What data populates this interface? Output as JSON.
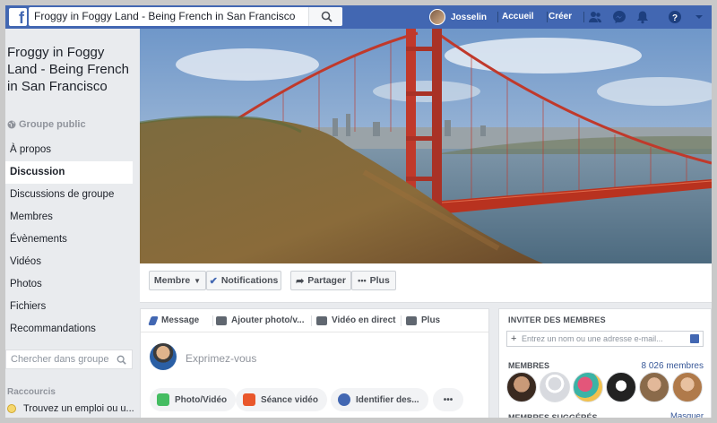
{
  "topbar": {
    "logo": "f",
    "search_value": "Froggy in Foggy Land - Being French in San Francisco",
    "user_name": "Josselin",
    "home_label": "Accueil",
    "create_label": "Créer",
    "icons": [
      "friends-icon",
      "messenger-icon",
      "bell-icon",
      "help-icon",
      "dropdown-icon"
    ],
    "brand_color": "#4267b2"
  },
  "group": {
    "title": "Froggy in Foggy Land - Being French in San Francisco",
    "privacy": "Groupe public"
  },
  "menu": {
    "items": [
      "À propos",
      "Discussion",
      "Discussions de groupe",
      "Membres",
      "Évènements",
      "Vidéos",
      "Photos",
      "Fichiers",
      "Recommandations"
    ],
    "active": "Discussion"
  },
  "left_search": {
    "placeholder": "Chercher dans groupe"
  },
  "shortcuts": {
    "heading": "Raccourcis",
    "item": "Trouvez un emploi ou u..."
  },
  "actions": {
    "member": "Membre",
    "notifications": "Notifications",
    "share": "Partager",
    "more": "Plus"
  },
  "composer": {
    "tabs": [
      "Message",
      "Ajouter photo/v...",
      "Vidéo en direct",
      "Plus"
    ],
    "placeholder": "Exprimez-vous",
    "pills": [
      "Photo/Vidéo",
      "Séance vidéo",
      "Identifier des..."
    ],
    "more_symbol": "•••"
  },
  "invite_panel": {
    "heading": "INVITER DES MEMBRES",
    "input_placeholder": "Entrez un nom ou une adresse e-mail...",
    "members_heading": "MEMBRES",
    "members_count": "8 026 membres",
    "suggested_heading": "MEMBRES SUGGÉRÉS",
    "hide_label": "Masquer"
  }
}
